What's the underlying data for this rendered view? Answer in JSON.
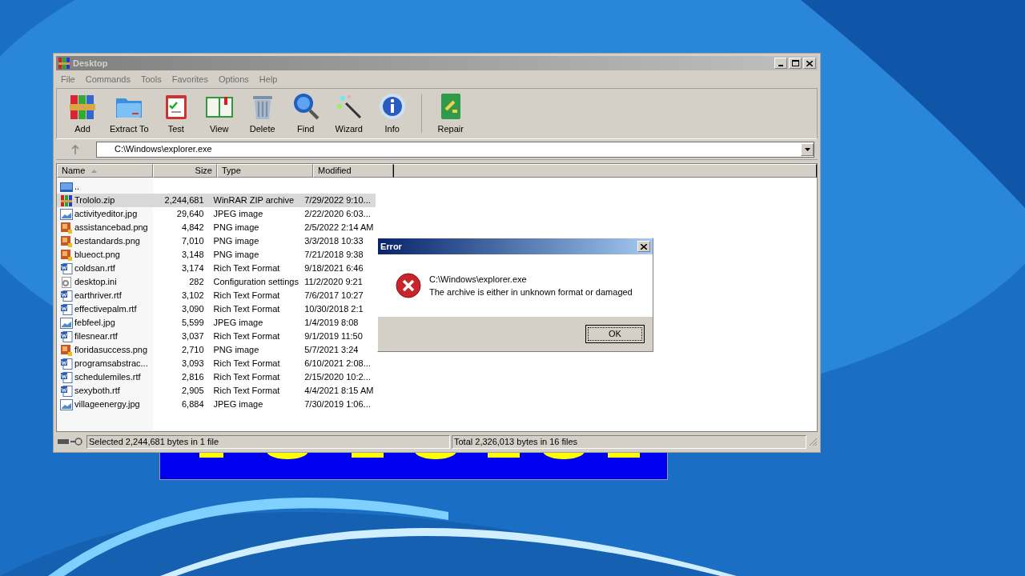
{
  "window": {
    "title": "Desktop"
  },
  "menu": [
    "File",
    "Commands",
    "Tools",
    "Favorites",
    "Options",
    "Help"
  ],
  "toolbar": [
    {
      "kind": "add",
      "label": "Add"
    },
    {
      "kind": "extract",
      "label": "Extract To"
    },
    {
      "kind": "test",
      "label": "Test"
    },
    {
      "kind": "view",
      "label": "View"
    },
    {
      "kind": "delete",
      "label": "Delete"
    },
    {
      "kind": "find",
      "label": "Find"
    },
    {
      "kind": "wizard",
      "label": "Wizard"
    },
    {
      "kind": "info",
      "label": "Info"
    },
    {
      "kind": "repair",
      "label": "Repair"
    }
  ],
  "address": {
    "value": "C:\\Windows\\explorer.exe"
  },
  "table": {
    "columns": [
      "Name",
      "Size",
      "Type",
      "Modified"
    ],
    "rows": [
      {
        "kind": "up",
        "name": "..",
        "selected": false
      },
      {
        "kind": "zip",
        "name": "Trololo.zip",
        "size": "2,244,681",
        "type": "WinRAR ZIP archive",
        "modified": "7/29/2022 9:10...",
        "selected": true
      },
      {
        "kind": "jpg",
        "name": "activityeditor.jpg",
        "size": "29,640",
        "type": "JPEG image",
        "modified": "2/22/2020 6:03...",
        "selected": false
      },
      {
        "kind": "png",
        "name": "assistancebad.png",
        "size": "4,842",
        "type": "PNG image",
        "modified": "2/5/2022 2:14 AM",
        "selected": false
      },
      {
        "kind": "png",
        "name": "bestandards.png",
        "size": "7,010",
        "type": "PNG image",
        "modified": "3/3/2018 10:33",
        "selected": false
      },
      {
        "kind": "png",
        "name": "blueoct.png",
        "size": "3,148",
        "type": "PNG image",
        "modified": "7/21/2018 9:38",
        "selected": false
      },
      {
        "kind": "rtf",
        "name": "coldsan.rtf",
        "size": "3,174",
        "type": "Rich Text Format",
        "modified": "9/18/2021 6:46",
        "selected": false
      },
      {
        "kind": "ini",
        "name": "desktop.ini",
        "size": "282",
        "type": "Configuration settings",
        "modified": "11/2/2020 9:21",
        "selected": false
      },
      {
        "kind": "rtf",
        "name": "earthriver.rtf",
        "size": "3,102",
        "type": "Rich Text Format",
        "modified": "7/6/2017 10:27",
        "selected": false
      },
      {
        "kind": "rtf",
        "name": "effectivepalm.rtf",
        "size": "3,090",
        "type": "Rich Text Format",
        "modified": "10/30/2018 2:1",
        "selected": false
      },
      {
        "kind": "jpg",
        "name": "febfeel.jpg",
        "size": "5,599",
        "type": "JPEG image",
        "modified": "1/4/2019 8:08",
        "selected": false
      },
      {
        "kind": "rtf",
        "name": "filesnear.rtf",
        "size": "3,037",
        "type": "Rich Text Format",
        "modified": "9/1/2019 11:50",
        "selected": false
      },
      {
        "kind": "png",
        "name": "floridasuccess.png",
        "size": "2,710",
        "type": "PNG image",
        "modified": "5/7/2021 3:24",
        "selected": false
      },
      {
        "kind": "rtf",
        "name": "programsabstrac...",
        "size": "3,093",
        "type": "Rich Text Format",
        "modified": "6/10/2021 2:08...",
        "selected": false
      },
      {
        "kind": "rtf",
        "name": "schedulemiles.rtf",
        "size": "2,816",
        "type": "Rich Text Format",
        "modified": "2/15/2020 10:2...",
        "selected": false
      },
      {
        "kind": "rtf",
        "name": "sexyboth.rtf",
        "size": "2,905",
        "type": "Rich Text Format",
        "modified": "4/4/2021 8:15 AM",
        "selected": false
      },
      {
        "kind": "jpg",
        "name": "villageenergy.jpg",
        "size": "6,884",
        "type": "JPEG image",
        "modified": "7/30/2019 1:06...",
        "selected": false
      }
    ]
  },
  "status_bar": {
    "left": "Selected 2,244,681 bytes in 1 file",
    "right": "Total 2,326,013 bytes in 16 files"
  },
  "dialog": {
    "title": "Error",
    "path": "C:\\Windows\\explorer.exe",
    "message": "The archive is either in unknown format or damaged",
    "button": "OK"
  }
}
